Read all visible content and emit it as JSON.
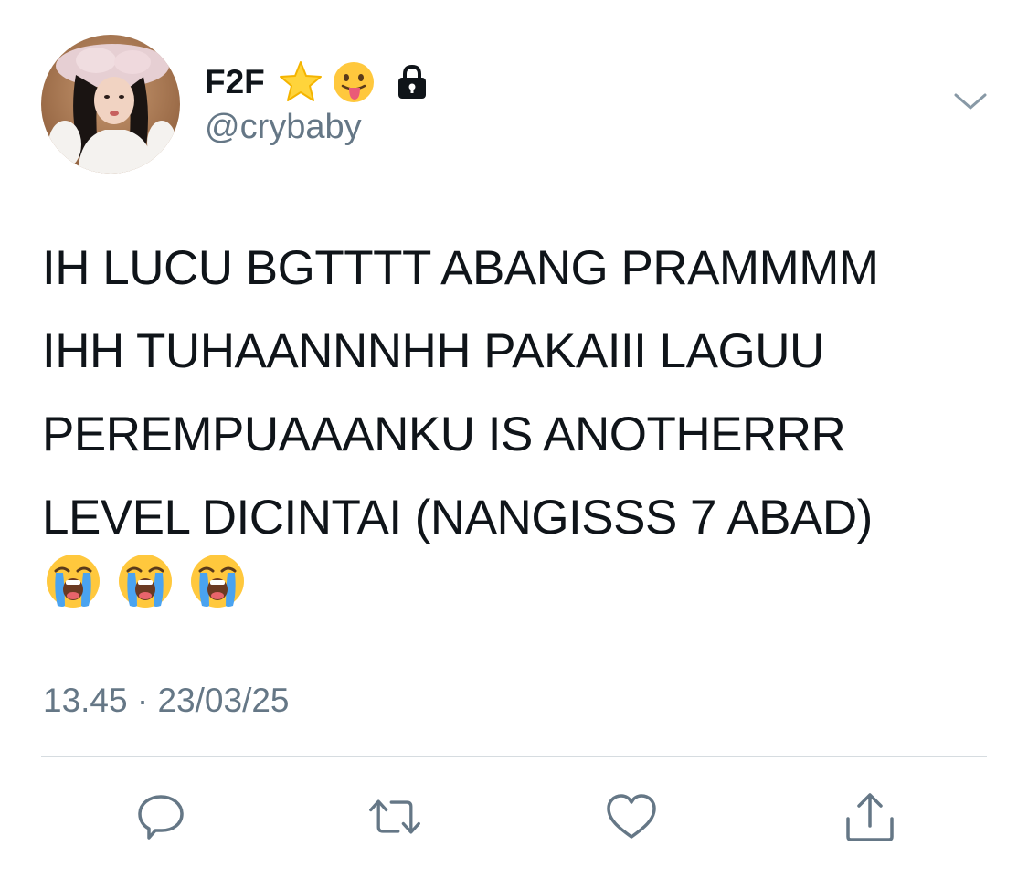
{
  "tweet": {
    "author": {
      "display_name": "F2F",
      "handle": "@crybaby",
      "name_icons": [
        "star-emoji-icon",
        "tongue-out-emoji-icon",
        "lock-icon"
      ],
      "avatar": "profile-photo"
    },
    "text_lines": [
      "IH LUCU BGTTTT ABANG PRAMMMM",
      "IHH TUHAANNNHH PAKAIII LAGUU",
      "PEREMPUAAANKU IS ANOTHERRR",
      "LEVEL DICINTAI (NANGISSS 7 ABAD)"
    ],
    "emojis": [
      "loudly-crying-face-icon",
      "loudly-crying-face-icon",
      "loudly-crying-face-icon"
    ],
    "time": "13.45",
    "separator": "·",
    "date": "23/03/25"
  },
  "actions": {
    "reply": "reply-icon",
    "retweet": "retweet-icon",
    "like": "heart-icon",
    "share": "share-icon"
  },
  "colors": {
    "text": "#0f1419",
    "secondary": "#657786",
    "icon": "#657786",
    "divider": "#d6dce0",
    "background": "#ffffff"
  }
}
